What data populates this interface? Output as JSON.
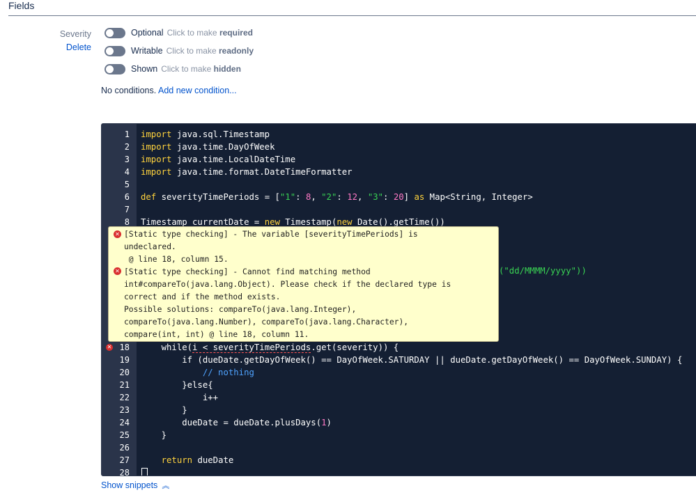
{
  "section": {
    "title": "Fields"
  },
  "field": {
    "name": "Severity",
    "delete_label": "Delete"
  },
  "toggles": [
    {
      "state": "Optional",
      "hint_prefix": "Click to make",
      "hint_target": "required"
    },
    {
      "state": "Writable",
      "hint_prefix": "Click to make",
      "hint_target": "readonly"
    },
    {
      "state": "Shown",
      "hint_prefix": "Click to make",
      "hint_target": "hidden"
    }
  ],
  "conditions": {
    "text": "No conditions.",
    "link": "Add new condition..."
  },
  "code_lines": [
    {
      "n": "1",
      "text": "import java.sql.Timestamp"
    },
    {
      "n": "2",
      "text": "import java.time.DayOfWeek"
    },
    {
      "n": "3",
      "text": "import java.time.LocalDateTime"
    },
    {
      "n": "4",
      "text": "import java.time.format.DateTimeFormatter"
    },
    {
      "n": "5",
      "text": ""
    },
    {
      "n": "6",
      "text": "def severityTimePeriods = [\"1\": 8, \"2\": 12, \"3\": 20] as Map<String, Integer>"
    },
    {
      "n": "7",
      "text": ""
    },
    {
      "n": "8",
      "text": "Timestamp currentDate = new Timestamp(new Date().getTime())"
    },
    {
      "n": "18",
      "text": "    while(i < severityTimePeriods.get(severity)) {"
    },
    {
      "n": "19",
      "text": "        if (dueDate.getDayOfWeek() == DayOfWeek.SATURDAY || dueDate.getDayOfWeek() == DayOfWeek.SUNDAY) {"
    },
    {
      "n": "20",
      "text": "            // nothing"
    },
    {
      "n": "21",
      "text": "        }else{"
    },
    {
      "n": "22",
      "text": "            i++"
    },
    {
      "n": "23",
      "text": "        }"
    },
    {
      "n": "24",
      "text": "        dueDate = dueDate.plusDays(1)"
    },
    {
      "n": "25",
      "text": "    }"
    },
    {
      "n": "26",
      "text": ""
    },
    {
      "n": "27",
      "text": "    return dueDate"
    },
    {
      "n": "28",
      "text": "}"
    }
  ],
  "hidden_fragment": "(\"dd/MMMM/yyyy\"))",
  "tooltip": {
    "lines": [
      "[Static type checking] - The variable [severityTimePeriods] is",
      "undeclared.",
      " @ line 18, column 15.",
      "[Static type checking] - Cannot find matching method",
      "int#compareTo(java.lang.Object). Please check if the declared type is",
      "correct and if the method exists.",
      "Possible solutions: compareTo(java.lang.Integer),",
      "compareTo(java.lang.Number), compareTo(java.lang.Character),",
      "compare(int, int) @ line 18, column 11."
    ]
  },
  "snippets": {
    "label": "Show snippets"
  },
  "icons": {
    "error": "error-icon",
    "chevron": "chevron-up-icon"
  },
  "colors": {
    "editor_bg": "#141f33",
    "keyword": "#ffd33d",
    "string": "#39d353",
    "number": "#ff79c6",
    "comment": "#4fa3ff",
    "link": "#0052cc",
    "tooltip_bg": "#ffffcc"
  }
}
